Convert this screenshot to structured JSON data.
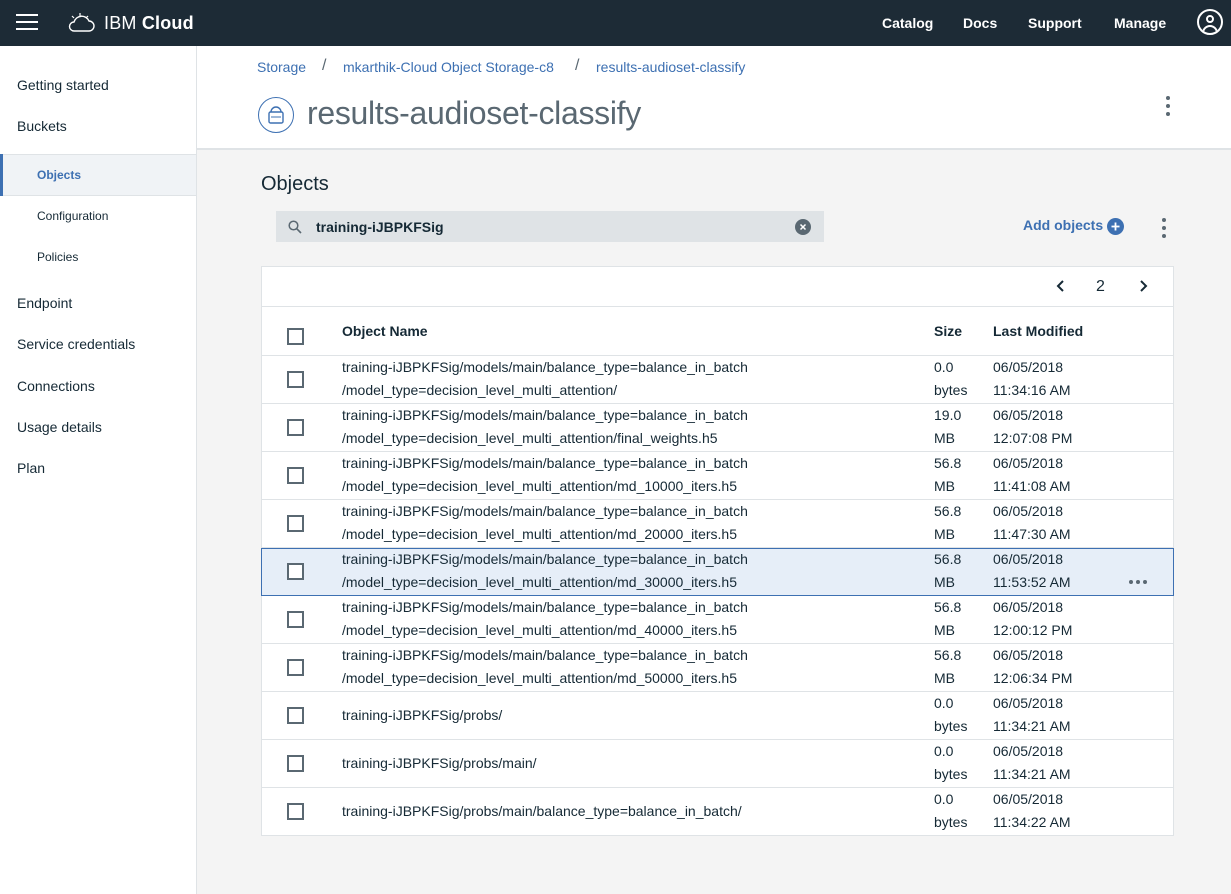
{
  "topbar": {
    "brand_prefix": "IBM",
    "brand_name": "Cloud",
    "nav": [
      "Catalog",
      "Docs",
      "Support",
      "Manage"
    ]
  },
  "sidebar": {
    "items": [
      {
        "label": "Getting started"
      },
      {
        "label": "Buckets"
      },
      {
        "label": "Objects",
        "active": true
      },
      {
        "label": "Configuration"
      },
      {
        "label": "Policies"
      },
      {
        "label": "Endpoint"
      },
      {
        "label": "Service credentials"
      },
      {
        "label": "Connections"
      },
      {
        "label": "Usage details"
      },
      {
        "label": "Plan"
      }
    ]
  },
  "breadcrumb": [
    "Storage",
    "mkarthik-Cloud Object Storage-c8",
    "results-audioset-classify"
  ],
  "page_title": "results-audioset-classify",
  "objects": {
    "title": "Objects",
    "search_value": "training-iJBPKFSig",
    "add_label": "Add objects",
    "page": "2",
    "columns": {
      "name": "Object Name",
      "size": "Size",
      "modified": "Last Modified"
    },
    "rows": [
      {
        "name1": "training-iJBPKFSig/models/main/balance_type=balance_in_batch",
        "name2": "/model_type=decision_level_multi_attention/",
        "size1": "0.0",
        "size2": "bytes",
        "date": "06/05/2018",
        "time": "11:34:16 AM"
      },
      {
        "name1": "training-iJBPKFSig/models/main/balance_type=balance_in_batch",
        "name2": "/model_type=decision_level_multi_attention/final_weights.h5",
        "size1": "19.0",
        "size2": "MB",
        "date": "06/05/2018",
        "time": "12:07:08 PM"
      },
      {
        "name1": "training-iJBPKFSig/models/main/balance_type=balance_in_batch",
        "name2": "/model_type=decision_level_multi_attention/md_10000_iters.h5",
        "size1": "56.8",
        "size2": "MB",
        "date": "06/05/2018",
        "time": "11:41:08 AM"
      },
      {
        "name1": "training-iJBPKFSig/models/main/balance_type=balance_in_batch",
        "name2": "/model_type=decision_level_multi_attention/md_20000_iters.h5",
        "size1": "56.8",
        "size2": "MB",
        "date": "06/05/2018",
        "time": "11:47:30 AM"
      },
      {
        "name1": "training-iJBPKFSig/models/main/balance_type=balance_in_batch",
        "name2": "/model_type=decision_level_multi_attention/md_30000_iters.h5",
        "size1": "56.8",
        "size2": "MB",
        "date": "06/05/2018",
        "time": "11:53:52 AM"
      },
      {
        "name1": "training-iJBPKFSig/models/main/balance_type=balance_in_batch",
        "name2": "/model_type=decision_level_multi_attention/md_40000_iters.h5",
        "size1": "56.8",
        "size2": "MB",
        "date": "06/05/2018",
        "time": "12:00:12 PM"
      },
      {
        "name1": "training-iJBPKFSig/models/main/balance_type=balance_in_batch",
        "name2": "/model_type=decision_level_multi_attention/md_50000_iters.h5",
        "size1": "56.8",
        "size2": "MB",
        "date": "06/05/2018",
        "time": "12:06:34 PM"
      },
      {
        "name1": "training-iJBPKFSig/probs/",
        "name2": "",
        "size1": "0.0",
        "size2": "bytes",
        "date": "06/05/2018",
        "time": "11:34:21 AM"
      },
      {
        "name1": "training-iJBPKFSig/probs/main/",
        "name2": "",
        "size1": "0.0",
        "size2": "bytes",
        "date": "06/05/2018",
        "time": "11:34:21 AM"
      },
      {
        "name1": "training-iJBPKFSig/probs/main/balance_type=balance_in_batch/",
        "name2": "",
        "size1": "0.0",
        "size2": "bytes",
        "date": "06/05/2018",
        "time": "11:34:22 AM"
      }
    ]
  },
  "colors": {
    "topbar": "#1d2b36",
    "accent": "#3d70b2",
    "selected_row": "#e6eef8"
  }
}
